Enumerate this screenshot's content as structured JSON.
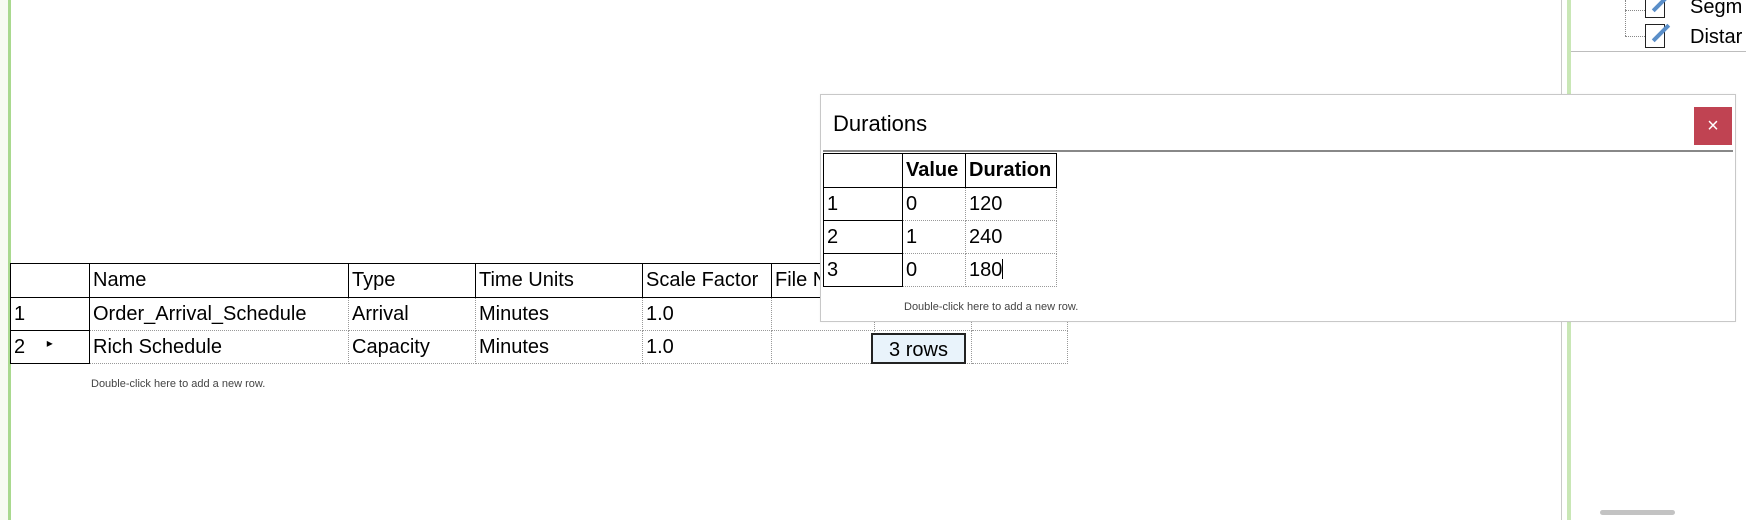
{
  "tree": {
    "items": [
      {
        "label": "Segm"
      },
      {
        "label": "Distar"
      }
    ]
  },
  "main_grid": {
    "columns": [
      "",
      "Name",
      "Type",
      "Time Units",
      "Scale Factor",
      "File N"
    ],
    "rows": [
      {
        "num": "1",
        "name": "Order_Arrival_Schedule",
        "type": "Arrival",
        "units": "Minutes",
        "scale": "1.0"
      },
      {
        "num": "2",
        "name": "Rich Schedule",
        "type": "Capacity",
        "units": "Minutes",
        "scale": "1.0"
      }
    ],
    "row2_marker": "▸",
    "add_row_hint": "Double-click here to add a new row.",
    "rows_button": "3 rows"
  },
  "durations_dialog": {
    "title": "Durations",
    "close_glyph": "×",
    "columns": [
      "",
      "Value",
      "Duration"
    ],
    "rows": [
      {
        "num": "1",
        "value": "0",
        "duration": "120"
      },
      {
        "num": "2",
        "value": "1",
        "duration": "240"
      },
      {
        "num": "3",
        "value": "0",
        "duration": "180"
      }
    ],
    "add_row_hint": "Double-click here to add a new row."
  }
}
